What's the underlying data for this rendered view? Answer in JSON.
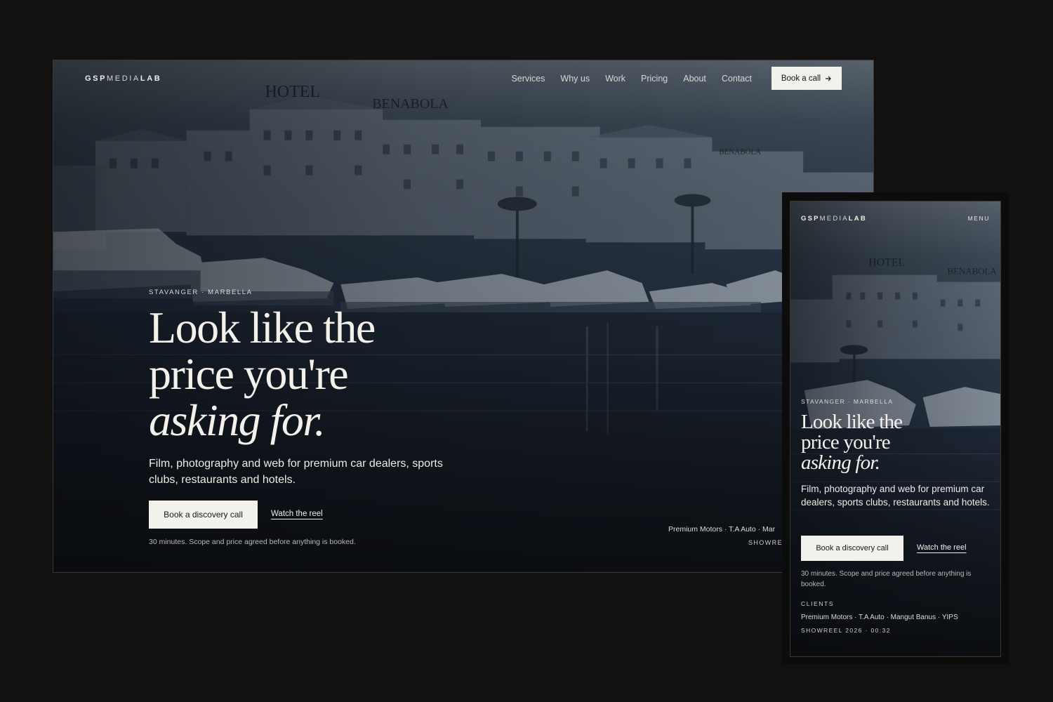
{
  "brand": {
    "bold_a": "GSP",
    "light": "MEDIA",
    "bold_b": "LAB"
  },
  "nav": {
    "items": [
      "Services",
      "Why us",
      "Work",
      "Pricing",
      "About",
      "Contact"
    ],
    "cta_label": "Book a call",
    "cta_icon": "arrow-right-icon"
  },
  "scene": {
    "sign_hotel": "HOTEL",
    "sign_benabola": "BENABOLA",
    "sign_small": "BENABOLA"
  },
  "hero": {
    "eyebrow": "STAVANGER · MARBELLA",
    "headline_line1": "Look like the",
    "headline_line2": "price you're",
    "headline_italic": "asking for.",
    "subheading": "Film, photography and web for premium car dealers, sports clubs, restaurants and hotels.",
    "primary_cta": "Book a discovery call",
    "secondary_cta": "Watch the reel",
    "note": "30 minutes. Scope and price agreed before anything is booked."
  },
  "desktop_footer": {
    "clients_line": "Premium Motors · T.A Auto · Mar",
    "showreel": "SHOWREE"
  },
  "mobile": {
    "menu_label": "MENU",
    "clients_label": "CLIENTS",
    "clients_line": "Premium Motors · T.A Auto · Mangut Banus · YIPS",
    "showreel": "SHOWREEL 2026 · 00:32"
  },
  "colors": {
    "page_bg": "#121010",
    "button_bg": "#f3f1ec",
    "text": "#f2efe9"
  }
}
